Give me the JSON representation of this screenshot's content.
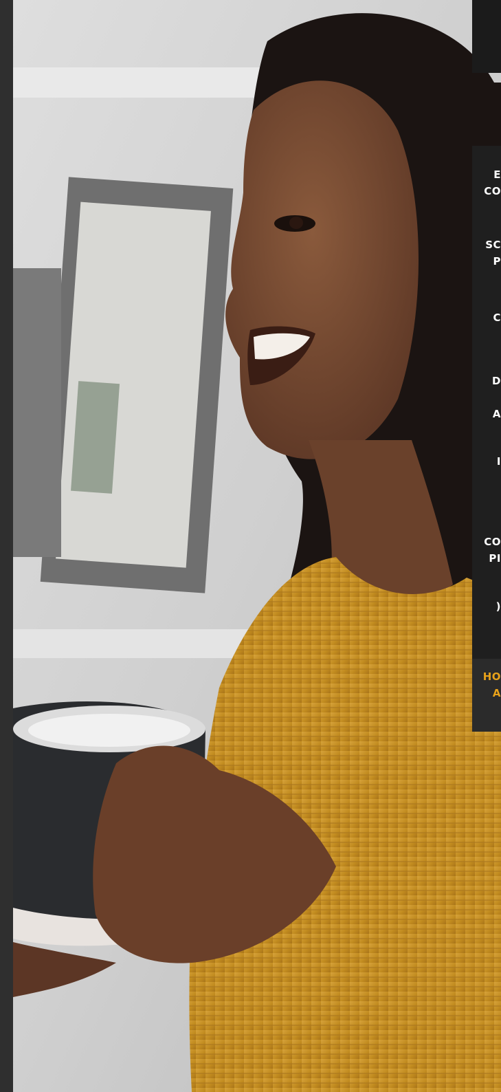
{
  "colors": {
    "menu_background": "#1f1f1f",
    "menu_text": "#ffffff",
    "active_text": "#e8a21a",
    "sweater": "#c9962a"
  },
  "hero": {
    "image": "smiling-woman-with-mug-photo"
  },
  "side_menu": {
    "items": [
      {
        "line1": "E",
        "line2": "CO"
      },
      {
        "line1": "SC",
        "line2": "P"
      },
      {
        "line1": "C",
        "line2": ""
      },
      {
        "line1": "D",
        "line2": "A"
      },
      {
        "line1": "I",
        "line2": ""
      },
      {
        "line1": "CO",
        "line2": "PI"
      },
      {
        "line1": "(",
        "line2": ""
      },
      {
        "line1": "HO",
        "line2": "A",
        "active": true
      }
    ]
  }
}
